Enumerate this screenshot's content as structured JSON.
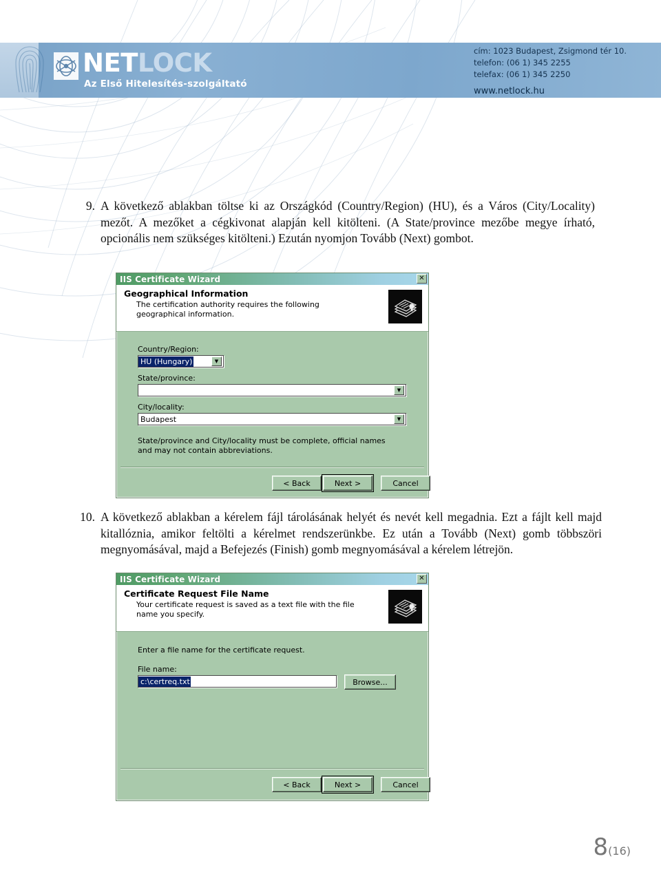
{
  "header": {
    "logo": {
      "brand_primary": "NET",
      "brand_secondary": "LOCK",
      "tagline": "Az Első Hitelesítés-szolgáltató",
      "mark_icon": "netlock-globe-icon",
      "fingerprint_icon": "fingerprint-icon"
    },
    "contact": {
      "address": "cím: 1023 Budapest, Zsigmond tér 10.",
      "phone": "telefon: (06 1) 345 2255",
      "fax": "telefax: (06 1) 345 2250",
      "website": "www.netlock.hu"
    }
  },
  "content": {
    "step9": {
      "number": "9.",
      "text": "A következő ablakban töltse ki az Országkód (Country/Region) (HU), és a Város (City/Locality) mezőt. A mezőket a cégkivonat alapján kell kitölteni. (A State/province mezőbe megye írható, opcionális nem szükséges kitölteni.) Ezután nyomjon Tovább (Next) gombot."
    },
    "step10": {
      "number": "10.",
      "text": "A következő ablakban a kérelem fájl tárolásának helyét és nevét kell megadnia. Ezt a fájlt kell majd kitallóznia, amikor feltölti a kérelmet rendszerünkbe. Ez után a Tovább (Next) gomb többszöri megnyomásával, majd a Befejezés (Finish) gomb megnyomásával a kérelem létrejön."
    }
  },
  "dialog_geo": {
    "window_title": "IIS Certificate Wizard",
    "close_label": "✕",
    "banner_title": "Geographical Information",
    "banner_subtitle": "The certification authority requires the following geographical information.",
    "banner_icon": "certificate-stack-icon",
    "country_label": "Country/Region:",
    "country_value": "HU (Hungary)",
    "state_label": "State/province:",
    "state_value": "",
    "city_label": "City/locality:",
    "city_value": "Budapest",
    "note": "State/province and City/locality must be complete, official names and may not contain abbreviations.",
    "buttons": {
      "back": "< Back",
      "next": "Next >",
      "cancel": "Cancel"
    }
  },
  "dialog_file": {
    "window_title": "IIS Certificate Wizard",
    "close_label": "✕",
    "banner_title": "Certificate Request File Name",
    "banner_subtitle": "Your certificate request is saved as a text file with the file name you specify.",
    "banner_icon": "certificate-stack-icon",
    "instruction": "Enter a file name for the certificate request.",
    "filename_label": "File name:",
    "filename_value": "c:\\certreq.txt",
    "browse_label": "Browse...",
    "buttons": {
      "back": "< Back",
      "next": "Next >",
      "cancel": "Cancel"
    }
  },
  "footer": {
    "page_current": "8",
    "page_total": "(16)"
  },
  "colors": {
    "band": "#7ba4c9",
    "dialog_face": "#a9c9ab",
    "titlebar_start": "#4f9b64",
    "titlebar_end": "#a8d7ea",
    "selection": "#0a246a"
  }
}
